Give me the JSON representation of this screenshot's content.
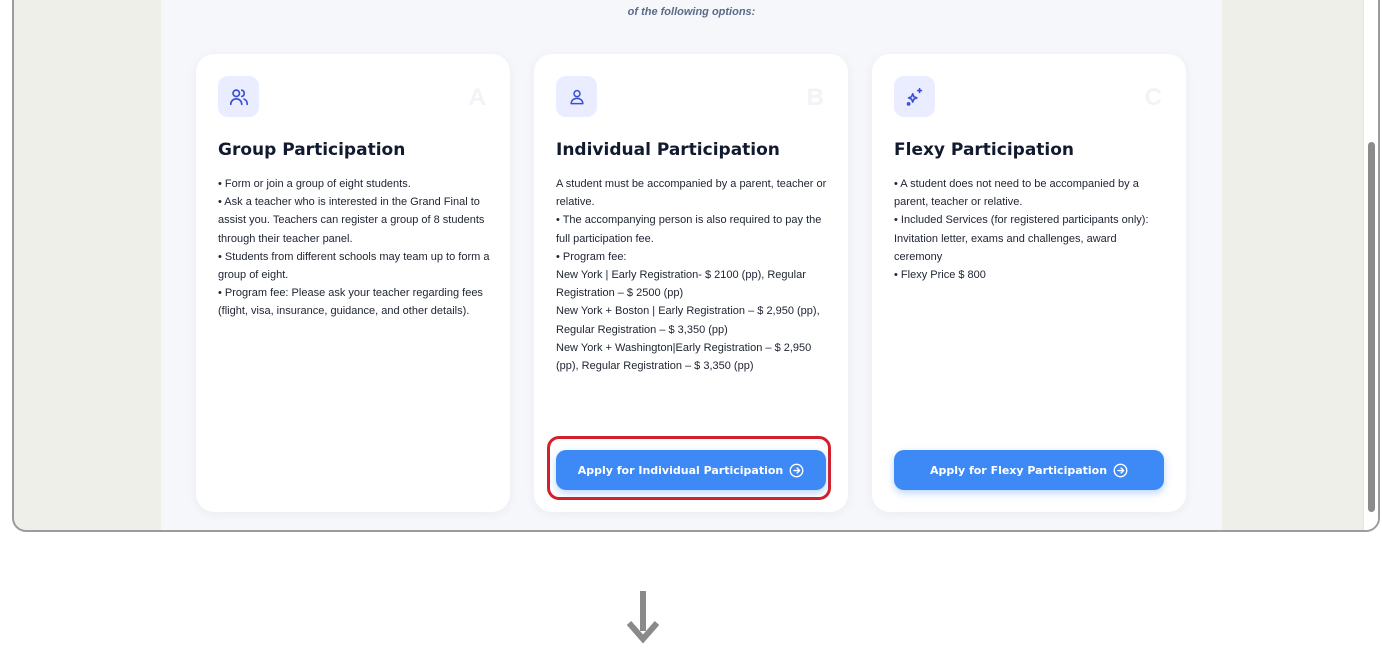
{
  "intro_text": "of the following options:",
  "cards": [
    {
      "letter": "A",
      "icon": "users-icon",
      "title": "Group Participation",
      "lines": [
        "• Form or join a group of eight students.",
        "• Ask a teacher who is interested in the Grand Final to assist you. Teachers can register a group of 8 students through their teacher panel.",
        "• Students from different schools may team up to form a group of eight.",
        "• Program fee: Please ask your teacher regarding fees (flight, visa, insurance, guidance, and other details)."
      ]
    },
    {
      "letter": "B",
      "icon": "user-icon",
      "title": "Individual Participation",
      "lines": [
        "A student must be accompanied by a parent, teacher or relative.",
        "• The accompanying person is also required to pay the full participation fee.",
        "• Program fee:",
        "New York  | Early Registration- $ 2100 (pp), Regular Registration – $ 2500 (pp)",
        "New York + Boston | Early Registration – $ 2,950 (pp), Regular Registration – $ 3,350 (pp)",
        "New York + Washington|Early Registration – $ 2,950 (pp), Regular Registration – $ 3,350 (pp)"
      ],
      "button_label": "Apply for Individual Participation"
    },
    {
      "letter": "C",
      "icon": "sparkles-icon",
      "title": "Flexy Participation",
      "lines": [
        "• A student does not need to be accompanied by a parent, teacher or relative.",
        "• Included Services (for registered participants only): Invitation letter, exams and challenges, award ceremony",
        "• Flexy Price $ 800"
      ],
      "button_label": "Apply for Flexy Participation"
    }
  ],
  "colors": {
    "accent": "#3d8af7",
    "highlight": "#d4202a",
    "icon_bg": "#e9edff",
    "icon_stroke": "#3b4fd6"
  },
  "annotation": {
    "highlighted_element": "apply-individual-button",
    "arrow": "down-arrow-icon"
  }
}
